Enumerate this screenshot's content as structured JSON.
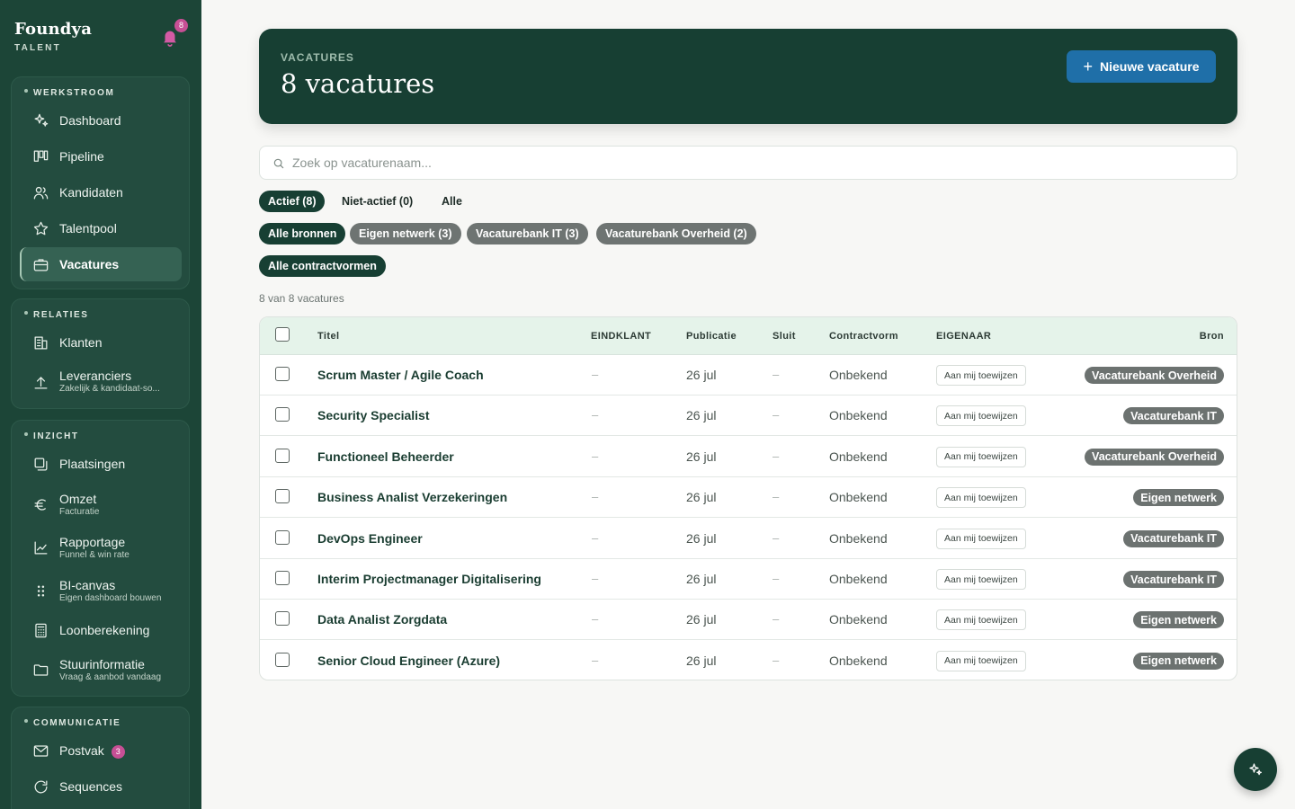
{
  "brand": {
    "name": "Foundya",
    "sub": "TALENT",
    "notifications": "8"
  },
  "sidebar": {
    "groups": [
      {
        "title": "WERKSTROOM",
        "items": [
          {
            "label": "Dashboard",
            "icon": "sparkles-icon"
          },
          {
            "label": "Pipeline",
            "icon": "kanban-icon"
          },
          {
            "label": "Kandidaten",
            "icon": "users-icon"
          },
          {
            "label": "Talentpool",
            "icon": "star-icon"
          },
          {
            "label": "Vacatures",
            "icon": "briefcase-icon",
            "active": true
          }
        ]
      },
      {
        "title": "RELATIES",
        "items": [
          {
            "label": "Klanten",
            "icon": "building-icon"
          },
          {
            "label": "Leveranciers",
            "sub": "Zakelijk & kandidaat-so...",
            "icon": "upload-icon"
          }
        ]
      },
      {
        "title": "INZICHT",
        "items": [
          {
            "label": "Plaatsingen",
            "icon": "copy-icon"
          },
          {
            "label": "Omzet",
            "sub": "Facturatie",
            "icon": "euro-icon"
          },
          {
            "label": "Rapportage",
            "sub": "Funnel & win rate",
            "icon": "chart-line-icon"
          },
          {
            "label": "BI-canvas",
            "sub": "Eigen dashboard bouwen",
            "icon": "grip-icon"
          },
          {
            "label": "Loonberekening",
            "icon": "calculator-icon"
          },
          {
            "label": "Stuurinformatie",
            "sub": "Vraag & aanbod vandaag",
            "icon": "folder-icon"
          }
        ]
      },
      {
        "title": "COMMUNICATIE",
        "items": [
          {
            "label": "Postvak",
            "count": "3",
            "icon": "mail-icon"
          },
          {
            "label": "Sequences",
            "icon": "refresh-icon"
          }
        ]
      }
    ]
  },
  "hero": {
    "eyebrow": "VACATURES",
    "title": "8 vacatures",
    "new_button": "Nieuwe vacature"
  },
  "search": {
    "placeholder": "Zoek op vacaturenaam..."
  },
  "filters": {
    "status": [
      "Actief (8)",
      "Niet-actief (0)",
      "Alle"
    ],
    "sources": [
      "Alle bronnen",
      "Eigen netwerk (3)",
      "Vacaturebank IT (3)",
      "Vacaturebank Overheid (2)"
    ],
    "contract": [
      "Alle contractvormen"
    ]
  },
  "count_text": "8 van 8 vacatures",
  "table": {
    "columns": [
      "Titel",
      "EINDKLANT",
      "Publicatie",
      "Sluit",
      "Contractvorm",
      "EIGENAAR",
      "Bron"
    ],
    "assign_label": "Aan mij toewijzen",
    "rows": [
      {
        "title": "Scrum Master / Agile Coach",
        "client": "–",
        "published": "26 jul",
        "closes": "–",
        "contract": "Onbekend",
        "source": "Vacaturebank Overheid"
      },
      {
        "title": "Security Specialist",
        "client": "–",
        "published": "26 jul",
        "closes": "–",
        "contract": "Onbekend",
        "source": "Vacaturebank IT"
      },
      {
        "title": "Functioneel Beheerder",
        "client": "–",
        "published": "26 jul",
        "closes": "–",
        "contract": "Onbekend",
        "source": "Vacaturebank Overheid"
      },
      {
        "title": "Business Analist Verzekeringen",
        "client": "–",
        "published": "26 jul",
        "closes": "–",
        "contract": "Onbekend",
        "source": "Eigen netwerk"
      },
      {
        "title": "DevOps Engineer",
        "client": "–",
        "published": "26 jul",
        "closes": "–",
        "contract": "Onbekend",
        "source": "Vacaturebank IT"
      },
      {
        "title": "Interim Projectmanager Digitalisering",
        "client": "–",
        "published": "26 jul",
        "closes": "–",
        "contract": "Onbekend",
        "source": "Vacaturebank IT"
      },
      {
        "title": "Data Analist Zorgdata",
        "client": "–",
        "published": "26 jul",
        "closes": "–",
        "contract": "Onbekend",
        "source": "Eigen netwerk"
      },
      {
        "title": "Senior Cloud Engineer (Azure)",
        "client": "–",
        "published": "26 jul",
        "closes": "–",
        "contract": "Onbekend",
        "source": "Eigen netwerk"
      }
    ]
  },
  "fab": {
    "icon": "sparkles-icon"
  }
}
